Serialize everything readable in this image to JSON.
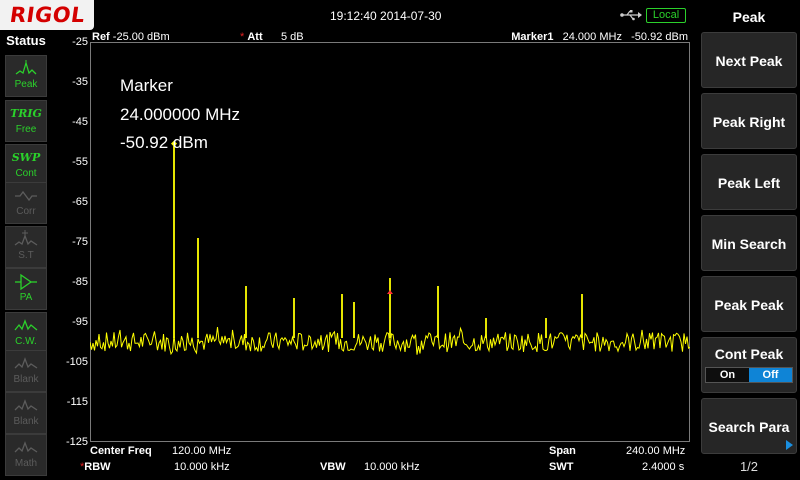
{
  "header": {
    "logo_text": "RIGOL",
    "datetime": "19:12:40 2014-07-30",
    "remote_badge": "Local",
    "usb_icon": "usb-icon"
  },
  "status_panel": {
    "title": "Status",
    "buttons": [
      {
        "name": "peak",
        "icon": "peak-icon",
        "label": "Peak",
        "state": "active"
      },
      {
        "name": "trig",
        "icon": "TRIG",
        "label": "Free",
        "state": "active"
      },
      {
        "name": "swp",
        "icon": "SWP",
        "label": "Cont",
        "state": "active"
      },
      {
        "name": "corr",
        "icon": "corr-icon",
        "label": "Corr",
        "state": "dim"
      },
      {
        "name": "st",
        "icon": "st-icon",
        "label": "S.T",
        "state": "dim"
      },
      {
        "name": "pa",
        "icon": "pa-icon",
        "label": "PA",
        "state": "active"
      },
      {
        "name": "cw",
        "icon": "cw-icon",
        "label": "C.W.",
        "state": "active"
      },
      {
        "name": "blank1",
        "icon": "blank-icon",
        "label": "Blank",
        "state": "dim"
      },
      {
        "name": "blank2",
        "icon": "blank-icon",
        "label": "Blank",
        "state": "dim"
      },
      {
        "name": "math",
        "icon": "math-icon",
        "label": "Math",
        "state": "dim"
      }
    ]
  },
  "plot": {
    "ref_label": "Ref",
    "ref_value": "-25.00 dBm",
    "att_label": "Att",
    "att_value": "5 dB",
    "marker_label": "Marker1",
    "marker_freq": "24.000 MHz",
    "marker_level": "-50.92 dBm",
    "marker_box": {
      "title": "Marker",
      "freq": "24.000000 MHz",
      "level": "-50.92 dBm"
    },
    "y_ticks": [
      "-25",
      "-35",
      "-45",
      "-55",
      "-65",
      "-75",
      "-85",
      "-95",
      "-105",
      "-115",
      "-125"
    ],
    "trace_color": "#ffff00",
    "marker_color": "#ff3030",
    "grid_color": "#7a7a7a"
  },
  "chart_data": {
    "type": "line",
    "xlim": [
      0,
      240
    ],
    "ylim": [
      -125,
      -25
    ],
    "noise_floor_dbm": -100,
    "peaks": [
      {
        "x": 24,
        "y": -51
      },
      {
        "x": 48,
        "y": -74
      },
      {
        "x": 96,
        "y": -86
      },
      {
        "x": 144,
        "y": -89
      },
      {
        "x": 192,
        "y": -88
      },
      {
        "x": 204,
        "y": -90
      },
      {
        "x": 240,
        "y": -84
      },
      {
        "x": 288,
        "y": -86
      },
      {
        "x": 336,
        "y": -94
      },
      {
        "x": 396,
        "y": -94
      },
      {
        "x": 432,
        "y": -88
      }
    ],
    "marker": {
      "x": 24,
      "y": -50.92
    }
  },
  "settings": {
    "center_label": "Center Freq",
    "center_value": "120.00 MHz",
    "span_label": "Span",
    "span_value": "240.00 MHz",
    "rbw_label": "RBW",
    "rbw_value": "10.000 kHz",
    "vbw_label": "VBW",
    "vbw_value": "10.000 kHz",
    "swt_label": "SWT",
    "swt_value": "2.4000 s"
  },
  "menu": {
    "title": "Peak",
    "keys": [
      "Next Peak",
      "Peak Right",
      "Peak Left",
      "Min Search",
      "Peak Peak",
      "Cont Peak",
      "Search Para"
    ],
    "cont_on": "On",
    "cont_off": "Off",
    "page": "1/2"
  }
}
